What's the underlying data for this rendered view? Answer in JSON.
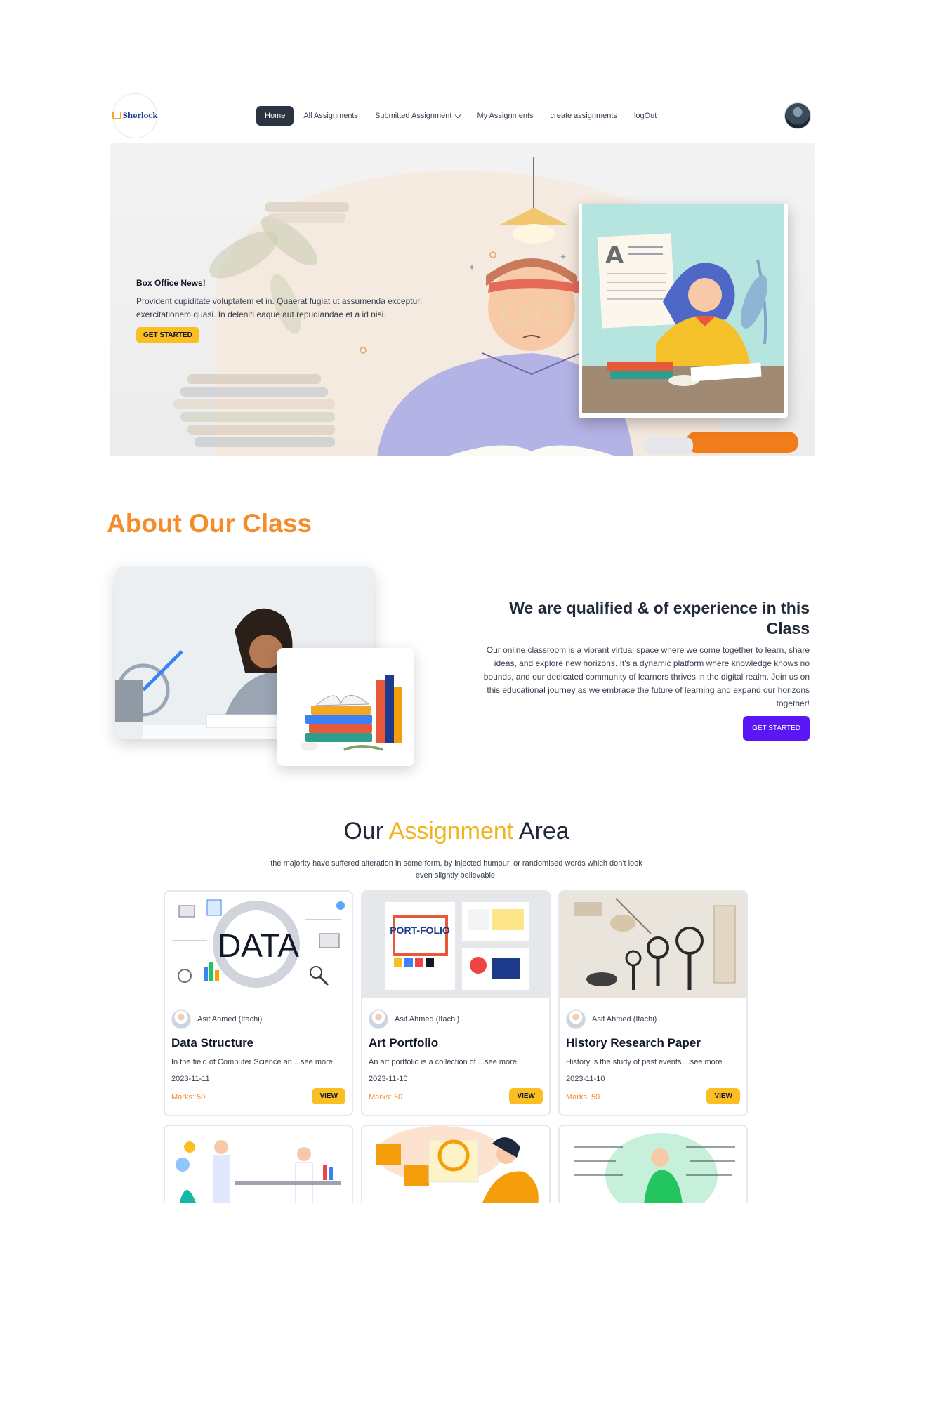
{
  "brand": {
    "logo_text": "Sherlock"
  },
  "nav": {
    "items": [
      {
        "label": "Home",
        "active": true
      },
      {
        "label": "All Assignments"
      },
      {
        "label": "Submitted Assignment"
      },
      {
        "label": "My Assignments"
      },
      {
        "label": "create assignments"
      },
      {
        "label": "logOut"
      }
    ]
  },
  "hero": {
    "title": "Box Office News!",
    "description": "Provident cupiditate voluptatem et in. Quaerat fugiat ut assumenda excepturi exercitationem quasi. In deleniti eaque aut repudiandae et a id nisi.",
    "button": "GET STARTED"
  },
  "about": {
    "title": "About Our Class",
    "heading": "We are qualified & of experience in this Class",
    "paragraph": "Our online classroom is a vibrant virtual space where we come together to learn, share ideas, and explore new horizons. It's a dynamic platform where knowledge knows no bounds, and our dedicated community of learners thrives in the digital realm. Join us on this educational journey as we embrace the future of learning and expand our horizons together!",
    "button": "GET STARTED"
  },
  "assignments": {
    "title_pre": "Our",
    "title_accent": "Assignment",
    "title_post": "Area",
    "subtitle": "the majority have suffered alteration in some form, by injected humour, or randomised words which don't look even slightly believable.",
    "cards": [
      {
        "author": "Asif Ahmed (Itachi)",
        "title": "Data Structure",
        "description": "In the field of Computer Science an ...see more",
        "date": "2023-11-11",
        "marks": "Marks: 50",
        "button": "VIEW",
        "image_text": "DATA"
      },
      {
        "author": "Asif Ahmed (Itachi)",
        "title": "Art Portfolio",
        "description": "An art portfolio is a collection of ...see more",
        "date": "2023-11-10",
        "marks": "Marks: 50",
        "button": "VIEW",
        "image_text": "PORT-FOLIO"
      },
      {
        "author": "Asif Ahmed (Itachi)",
        "title": "History Research Paper",
        "description": "History is the study of past events ...see more",
        "date": "2023-11-10",
        "marks": "Marks: 50",
        "button": "VIEW"
      }
    ]
  },
  "colors": {
    "accent_orange": "#f68b29",
    "accent_yellow": "#fbbf24",
    "purple": "#5b16f5",
    "nav_active": "#2b3440"
  }
}
